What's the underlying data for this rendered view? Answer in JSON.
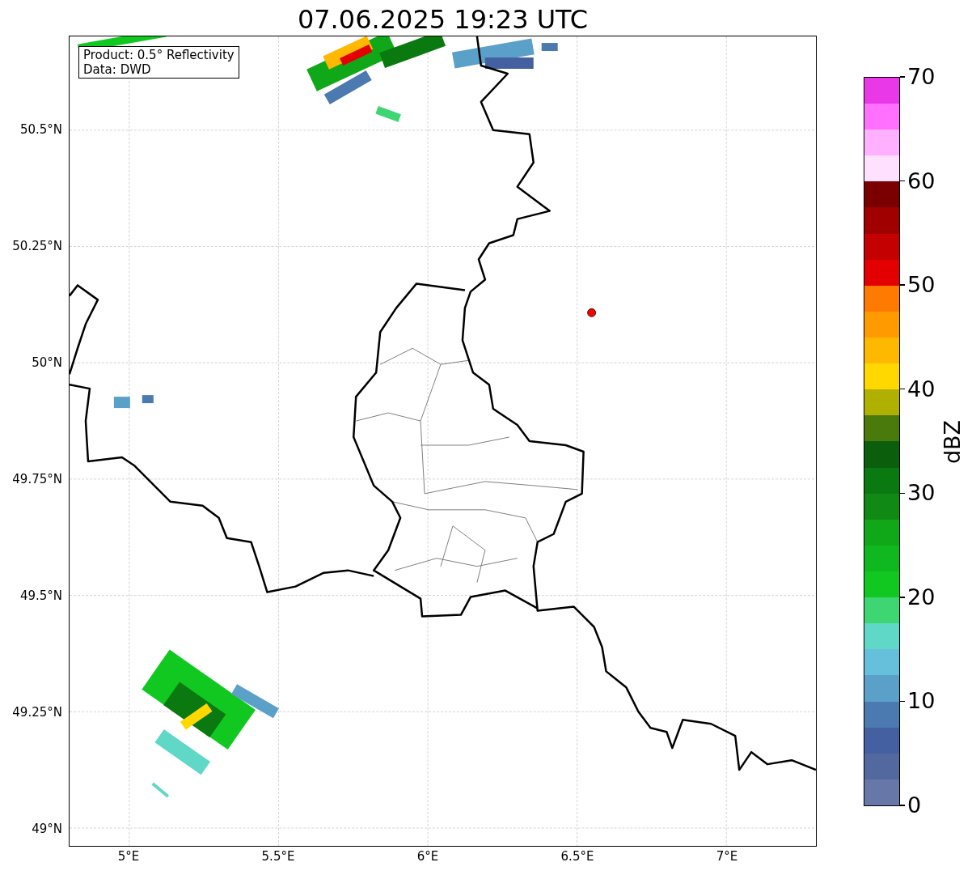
{
  "title": "07.06.2025 19:23 UTC",
  "legend": [
    "Product: 0.5° Reflectivity",
    "Data: DWD"
  ],
  "lat_ticks": [
    "50.5°N",
    "50.25°N",
    "50°N",
    "49.75°N",
    "49.5°N",
    "49.25°N",
    "49°N"
  ],
  "lon_ticks": [
    "5°E",
    "5.5°E",
    "6°E",
    "6.5°E",
    "7°E"
  ],
  "colorbar": {
    "label": "dBZ",
    "ticks": [
      "70",
      "60",
      "50",
      "40",
      "30",
      "20",
      "10",
      "0"
    ],
    "segments": [
      {
        "color": "#6677a8"
      },
      {
        "color": "#5468a0"
      },
      {
        "color": "#4460a0"
      },
      {
        "color": "#4a7ab0"
      },
      {
        "color": "#5aa0c8"
      },
      {
        "color": "#66c0dc"
      },
      {
        "color": "#60d8c8"
      },
      {
        "color": "#3ed672"
      },
      {
        "color": "#10c820"
      },
      {
        "color": "#10b820"
      },
      {
        "color": "#10a818"
      },
      {
        "color": "#108a14"
      },
      {
        "color": "#0a7a10"
      },
      {
        "color": "#0a5e0c"
      },
      {
        "color": "#4a7a0c"
      },
      {
        "color": "#b0b000"
      },
      {
        "color": "#ffd800"
      },
      {
        "color": "#ffb800"
      },
      {
        "color": "#ff9a00"
      },
      {
        "color": "#ff7a00"
      },
      {
        "color": "#e40000"
      },
      {
        "color": "#c40000"
      },
      {
        "color": "#a00000"
      },
      {
        "color": "#7a0000"
      },
      {
        "color": "#ffe0ff"
      },
      {
        "color": "#ffb0ff"
      },
      {
        "color": "#ff70ff"
      },
      {
        "color": "#e838e8"
      }
    ]
  }
}
